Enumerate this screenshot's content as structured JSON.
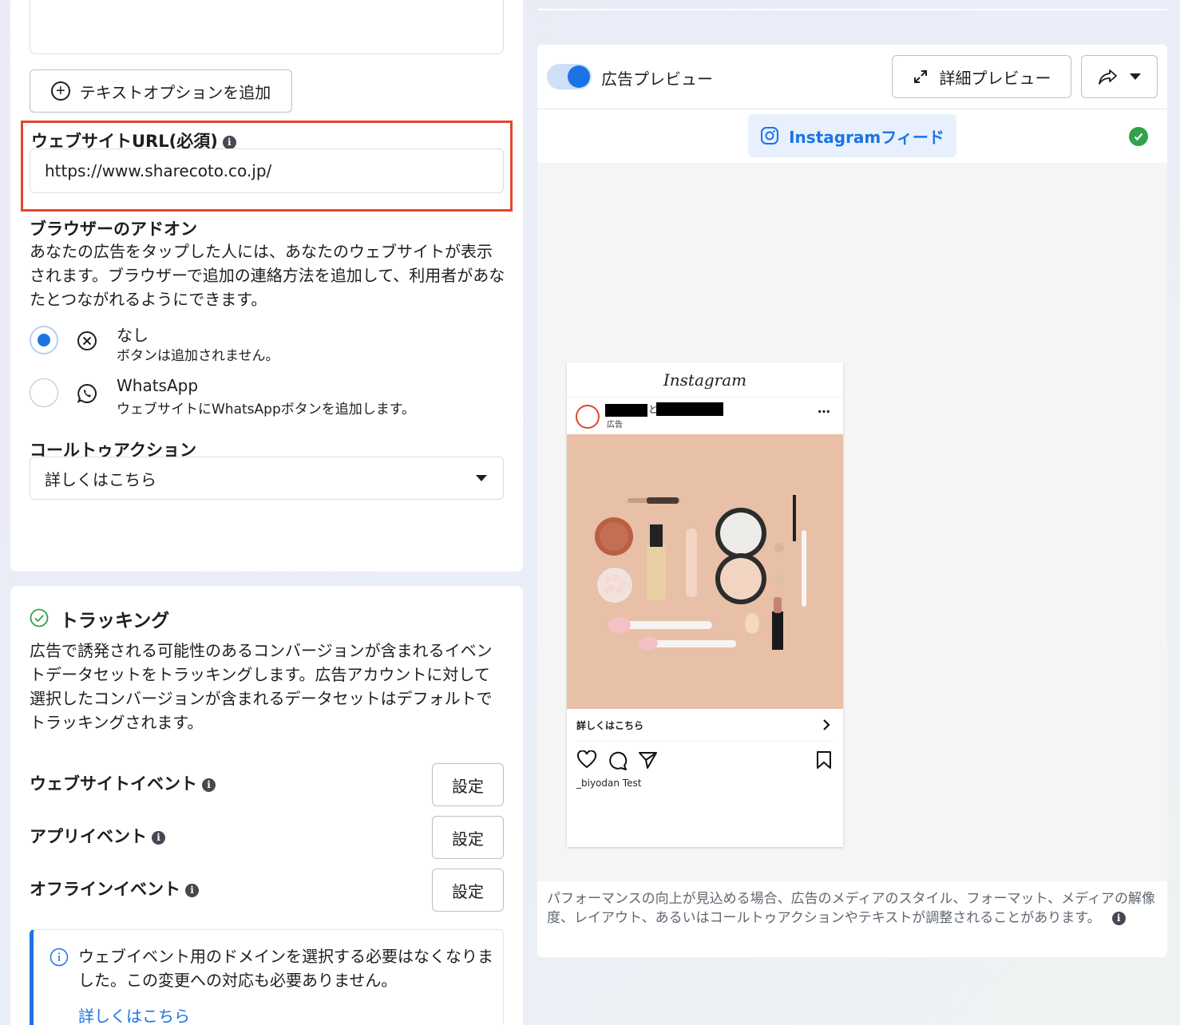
{
  "form": {
    "add_text_option": "テキストオプションを追加",
    "website_url_label": "ウェブサイトURL(必須)",
    "website_url_value": "https://www.sharecoto.co.jp/",
    "browser_addon_title": "ブラウザーのアドオン",
    "browser_addon_desc": "あなたの広告をタップした人には、あなたのウェブサイトが表示されます。ブラウザーで追加の連絡方法を追加して、利用者があなたとつながれるようにできます。",
    "options": [
      {
        "title": "なし",
        "sub": "ボタンは追加されません。",
        "selected": true
      },
      {
        "title": "WhatsApp",
        "sub": "ウェブサイトにWhatsAppボタンを追加します。",
        "selected": false
      }
    ],
    "cta_label": "コールトゥアクション",
    "cta_value": "詳しくはこちら"
  },
  "tracking": {
    "title": "トラッキング",
    "desc": "広告で誘発される可能性のあるコンバージョンが含まれるイベントデータセットをトラッキングします。広告アカウントに対して選択したコンバージョンが含まれるデータセットはデフォルトでトラッキングされます。",
    "rows": [
      {
        "label": "ウェブサイトイベント",
        "button": "設定"
      },
      {
        "label": "アプリイベント",
        "button": "設定"
      },
      {
        "label": "オフラインイベント",
        "button": "設定"
      }
    ],
    "notice_text": "ウェブイベント用のドメインを選択する必要はなくなりました。この変更への対応も必要ありません。",
    "notice_link": "詳しくはこちら"
  },
  "preview": {
    "toggle_label": "広告プレビュー",
    "detail_button": "詳細プレビュー",
    "placement_tab": "Instagramフィード",
    "ig_logo": "Instagram",
    "account_joiner": "と",
    "sponsored": "広告",
    "cta_bar": "詳しくはこちら",
    "username_caption": "_biyodan Test",
    "footer_note": "パフォーマンスの向上が見込める場合、広告のメディアのスタイル、フォーマット、メディアの解像度、レイアウト、あるいはコールトゥアクションやテキストが調整されることがあります。"
  },
  "colors": {
    "accent": "#1b74e4",
    "highlight_border": "#e3452f",
    "success": "#31a24c"
  }
}
